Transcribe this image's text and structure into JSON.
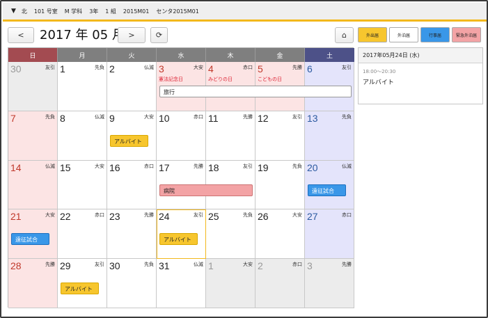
{
  "topbar": {
    "collapse": "▼",
    "items": [
      "北",
      "101 号室",
      "M 学科",
      "3年",
      "1 組",
      "2015M01",
      "センタ2015M01"
    ]
  },
  "nav": {
    "prev": "<",
    "next": ">",
    "refresh": "⟳",
    "home": "⌂",
    "title": "2017 年 05 月"
  },
  "weekdays": [
    {
      "label": "日",
      "color": "#a34b51"
    },
    {
      "label": "月",
      "color": "#7f7f7f"
    },
    {
      "label": "火",
      "color": "#7f7f7f"
    },
    {
      "label": "水",
      "color": "#7f7f7f"
    },
    {
      "label": "木",
      "color": "#7f7f7f"
    },
    {
      "label": "金",
      "color": "#7f7f7f"
    },
    {
      "label": "土",
      "color": "#4d5188"
    }
  ],
  "weeks": [
    [
      {
        "d": "30",
        "r": "友引",
        "t": "other"
      },
      {
        "d": "1",
        "r": "先負",
        "t": ""
      },
      {
        "d": "2",
        "r": "仏滅",
        "t": ""
      },
      {
        "d": "3",
        "r": "大安",
        "t": "hol",
        "h": "憲法記念日"
      },
      {
        "d": "4",
        "r": "赤口",
        "t": "hol",
        "h": "みどりの日"
      },
      {
        "d": "5",
        "r": "先勝",
        "t": "hol",
        "h": "こどもの日"
      },
      {
        "d": "6",
        "r": "友引",
        "t": "sat"
      }
    ],
    [
      {
        "d": "7",
        "r": "先負",
        "t": "sun"
      },
      {
        "d": "8",
        "r": "仏滅",
        "t": ""
      },
      {
        "d": "9",
        "r": "大安",
        "t": ""
      },
      {
        "d": "10",
        "r": "赤口",
        "t": ""
      },
      {
        "d": "11",
        "r": "先勝",
        "t": ""
      },
      {
        "d": "12",
        "r": "友引",
        "t": ""
      },
      {
        "d": "13",
        "r": "先負",
        "t": "sat"
      }
    ],
    [
      {
        "d": "14",
        "r": "仏滅",
        "t": "sun"
      },
      {
        "d": "15",
        "r": "大安",
        "t": ""
      },
      {
        "d": "16",
        "r": "赤口",
        "t": ""
      },
      {
        "d": "17",
        "r": "先勝",
        "t": ""
      },
      {
        "d": "18",
        "r": "友引",
        "t": ""
      },
      {
        "d": "19",
        "r": "先負",
        "t": ""
      },
      {
        "d": "20",
        "r": "仏滅",
        "t": "sat"
      }
    ],
    [
      {
        "d": "21",
        "r": "大安",
        "t": "sun"
      },
      {
        "d": "22",
        "r": "赤口",
        "t": ""
      },
      {
        "d": "23",
        "r": "先勝",
        "t": ""
      },
      {
        "d": "24",
        "r": "友引",
        "t": "today"
      },
      {
        "d": "25",
        "r": "先負",
        "t": ""
      },
      {
        "d": "26",
        "r": "大安",
        "t": ""
      },
      {
        "d": "27",
        "r": "赤口",
        "t": "sat"
      }
    ],
    [
      {
        "d": "28",
        "r": "先勝",
        "t": "sun"
      },
      {
        "d": "29",
        "r": "友引",
        "t": ""
      },
      {
        "d": "30",
        "r": "先負",
        "t": ""
      },
      {
        "d": "31",
        "r": "仏滅",
        "t": ""
      },
      {
        "d": "1",
        "r": "大安",
        "t": "other"
      },
      {
        "d": "2",
        "r": "赤口",
        "t": "other"
      },
      {
        "d": "3",
        "r": "先勝",
        "t": "other"
      }
    ]
  ],
  "events": [
    {
      "label": "旅行",
      "week": 0,
      "start": 3,
      "span": 4,
      "color": "white"
    },
    {
      "label": "アルバイト",
      "week": 1,
      "start": 2,
      "span": 1,
      "color": "yellow"
    },
    {
      "label": "病院",
      "week": 2,
      "start": 3,
      "span": 2,
      "color": "pink"
    },
    {
      "label": "遠征試合",
      "week": 2,
      "start": 6,
      "span": 1,
      "color": "blue"
    },
    {
      "label": "遠征試合",
      "week": 3,
      "start": 0,
      "span": 1,
      "color": "blue"
    },
    {
      "label": "アルバイト",
      "week": 3,
      "start": 3,
      "span": 1,
      "color": "yellow"
    },
    {
      "label": "アルバイト",
      "week": 4,
      "start": 1,
      "span": 1,
      "color": "yellow"
    }
  ],
  "legend": [
    {
      "label": "外出届",
      "bg": "#f7c62e"
    },
    {
      "label": "外泊届",
      "bg": "#ffffff"
    },
    {
      "label": "行事届",
      "bg": "#3a97e8"
    },
    {
      "label": "緊急外泊届",
      "bg": "#f3a3a5"
    }
  ],
  "detail": {
    "date": "2017年05月24日 (水)",
    "time": "18:00〜20:30",
    "title": "アルバイト"
  }
}
